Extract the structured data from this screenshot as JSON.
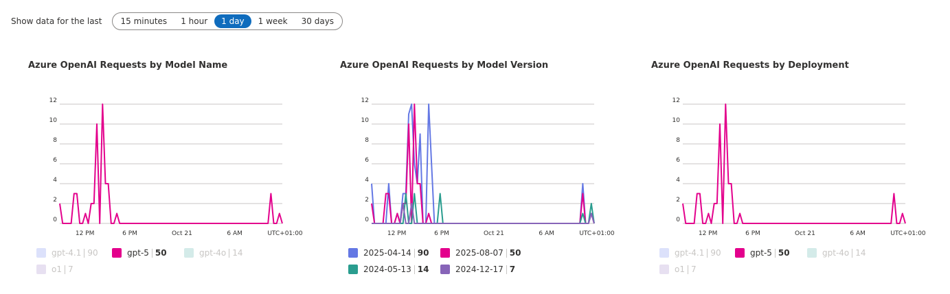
{
  "time_range": {
    "label": "Show data for the last",
    "options": [
      "15 minutes",
      "1 hour",
      "1 day",
      "1 week",
      "30 days"
    ],
    "selected": "1 day"
  },
  "chart_data": [
    {
      "type": "line",
      "title": "Azure OpenAI Requests by Model Name",
      "yticks": [
        0,
        2,
        4,
        6,
        8,
        10,
        12
      ],
      "ylim": [
        0,
        12
      ],
      "xticks": [
        "12 PM",
        "6 PM",
        "Oct 21",
        "6 AM"
      ],
      "timezone": "UTC+01:00",
      "grid": true,
      "series": [
        {
          "name": "gpt-5",
          "color": "#e3008c",
          "visible": true,
          "values": [
            2,
            0,
            0,
            0,
            0,
            3,
            3,
            0,
            0,
            1,
            0,
            2,
            2,
            10,
            0,
            12,
            4,
            4,
            0,
            0,
            1,
            0,
            0,
            0,
            0,
            0,
            0,
            0,
            0,
            0,
            0,
            0,
            0,
            0,
            0,
            0,
            0,
            0,
            0,
            0,
            0,
            0,
            0,
            0,
            0,
            0,
            0,
            0,
            0,
            0,
            0,
            0,
            0,
            0,
            0,
            0,
            0,
            0,
            0,
            0,
            0,
            0,
            0,
            0,
            0,
            0,
            0,
            0,
            0,
            0,
            0,
            0,
            0,
            0,
            3,
            0,
            0,
            1,
            0
          ]
        }
      ],
      "legend": [
        {
          "name": "gpt-4.1",
          "count": "90",
          "color": "#4f6bed",
          "active": false
        },
        {
          "name": "gpt-5",
          "count": "50",
          "color": "#e3008c",
          "active": true
        },
        {
          "name": "gpt-4o",
          "count": "14",
          "color": "#2a9d8f",
          "active": false
        },
        {
          "name": "o1",
          "count": "7",
          "color": "#8764b8",
          "active": false
        }
      ]
    },
    {
      "type": "line",
      "title": "Azure OpenAI Requests by Model Version",
      "yticks": [
        0,
        2,
        4,
        6,
        8,
        10,
        12
      ],
      "ylim": [
        0,
        12
      ],
      "xticks": [
        "12 PM",
        "6 PM",
        "Oct 21",
        "6 AM"
      ],
      "timezone": "UTC+01:00",
      "grid": true,
      "series": [
        {
          "name": "2025-04-14",
          "color": "#6478e4",
          "visible": true,
          "values": [
            4,
            0,
            0,
            0,
            0,
            0,
            4,
            0,
            0,
            1,
            0,
            3,
            3,
            11,
            12,
            6,
            4,
            9,
            0,
            0,
            12,
            6,
            0,
            0,
            0,
            0,
            0,
            0,
            0,
            0,
            0,
            0,
            0,
            0,
            0,
            0,
            0,
            0,
            0,
            0,
            0,
            0,
            0,
            0,
            0,
            0,
            0,
            0,
            0,
            0,
            0,
            0,
            0,
            0,
            0,
            0,
            0,
            0,
            0,
            0,
            0,
            0,
            0,
            0,
            0,
            0,
            0,
            0,
            0,
            0,
            0,
            0,
            0,
            0,
            4,
            0,
            0,
            1,
            0
          ]
        },
        {
          "name": "2025-08-07",
          "color": "#e3008c",
          "visible": true,
          "values": [
            2,
            0,
            0,
            0,
            0,
            3,
            3,
            0,
            0,
            1,
            0,
            2,
            2,
            10,
            0,
            12,
            4,
            4,
            0,
            0,
            1,
            0,
            0,
            0,
            0,
            0,
            0,
            0,
            0,
            0,
            0,
            0,
            0,
            0,
            0,
            0,
            0,
            0,
            0,
            0,
            0,
            0,
            0,
            0,
            0,
            0,
            0,
            0,
            0,
            0,
            0,
            0,
            0,
            0,
            0,
            0,
            0,
            0,
            0,
            0,
            0,
            0,
            0,
            0,
            0,
            0,
            0,
            0,
            0,
            0,
            0,
            0,
            0,
            0,
            3,
            0,
            0,
            1,
            0
          ]
        },
        {
          "name": "2024-05-13",
          "color": "#2a9d8f",
          "visible": true,
          "values": [
            0,
            0,
            0,
            0,
            0,
            0,
            0,
            0,
            0,
            0,
            0,
            0,
            3,
            0,
            0,
            3,
            0,
            0,
            0,
            0,
            0,
            0,
            0,
            0,
            3,
            0,
            0,
            0,
            0,
            0,
            0,
            0,
            0,
            0,
            0,
            0,
            0,
            0,
            0,
            0,
            0,
            0,
            0,
            0,
            0,
            0,
            0,
            0,
            0,
            0,
            0,
            0,
            0,
            0,
            0,
            0,
            0,
            0,
            0,
            0,
            0,
            0,
            0,
            0,
            0,
            0,
            0,
            0,
            0,
            0,
            0,
            0,
            0,
            0,
            1,
            0,
            0,
            2,
            0
          ]
        },
        {
          "name": "2024-12-17",
          "color": "#8764b8",
          "visible": true,
          "values": [
            0,
            0,
            0,
            0,
            0,
            0,
            0,
            0,
            0,
            0,
            0,
            2,
            0,
            0,
            2,
            0,
            0,
            0,
            0,
            0,
            0,
            0,
            0,
            0,
            0,
            0,
            0,
            0,
            0,
            0,
            0,
            0,
            0,
            0,
            0,
            0,
            0,
            0,
            0,
            0,
            0,
            0,
            0,
            0,
            0,
            0,
            0,
            0,
            0,
            0,
            0,
            0,
            0,
            0,
            0,
            0,
            0,
            0,
            0,
            0,
            0,
            0,
            0,
            0,
            0,
            0,
            0,
            0,
            0,
            0,
            0,
            0,
            0,
            0,
            0,
            0,
            0,
            1,
            0
          ]
        }
      ],
      "legend": [
        {
          "name": "2025-04-14",
          "count": "90",
          "color": "#6478e4",
          "active": true
        },
        {
          "name": "2025-08-07",
          "count": "50",
          "color": "#e3008c",
          "active": true
        },
        {
          "name": "2024-05-13",
          "count": "14",
          "color": "#2a9d8f",
          "active": true
        },
        {
          "name": "2024-12-17",
          "count": "7",
          "color": "#8764b8",
          "active": true
        }
      ]
    },
    {
      "type": "line",
      "title": "Azure OpenAI Requests by Deployment",
      "yticks": [
        0,
        2,
        4,
        6,
        8,
        10,
        12
      ],
      "ylim": [
        0,
        12
      ],
      "xticks": [
        "12 PM",
        "6 PM",
        "Oct 21",
        "6 AM"
      ],
      "timezone": "UTC+01:00",
      "grid": true,
      "series": [
        {
          "name": "gpt-5",
          "color": "#e3008c",
          "visible": true,
          "values": [
            2,
            0,
            0,
            0,
            0,
            3,
            3,
            0,
            0,
            1,
            0,
            2,
            2,
            10,
            0,
            12,
            4,
            4,
            0,
            0,
            1,
            0,
            0,
            0,
            0,
            0,
            0,
            0,
            0,
            0,
            0,
            0,
            0,
            0,
            0,
            0,
            0,
            0,
            0,
            0,
            0,
            0,
            0,
            0,
            0,
            0,
            0,
            0,
            0,
            0,
            0,
            0,
            0,
            0,
            0,
            0,
            0,
            0,
            0,
            0,
            0,
            0,
            0,
            0,
            0,
            0,
            0,
            0,
            0,
            0,
            0,
            0,
            0,
            0,
            3,
            0,
            0,
            1,
            0
          ]
        }
      ],
      "legend": [
        {
          "name": "gpt-4.1",
          "count": "90",
          "color": "#4f6bed",
          "active": false
        },
        {
          "name": "gpt-5",
          "count": "50",
          "color": "#e3008c",
          "active": true
        },
        {
          "name": "gpt-4o",
          "count": "14",
          "color": "#2a9d8f",
          "active": false
        },
        {
          "name": "o1",
          "count": "7",
          "color": "#8764b8",
          "active": false
        }
      ]
    }
  ]
}
